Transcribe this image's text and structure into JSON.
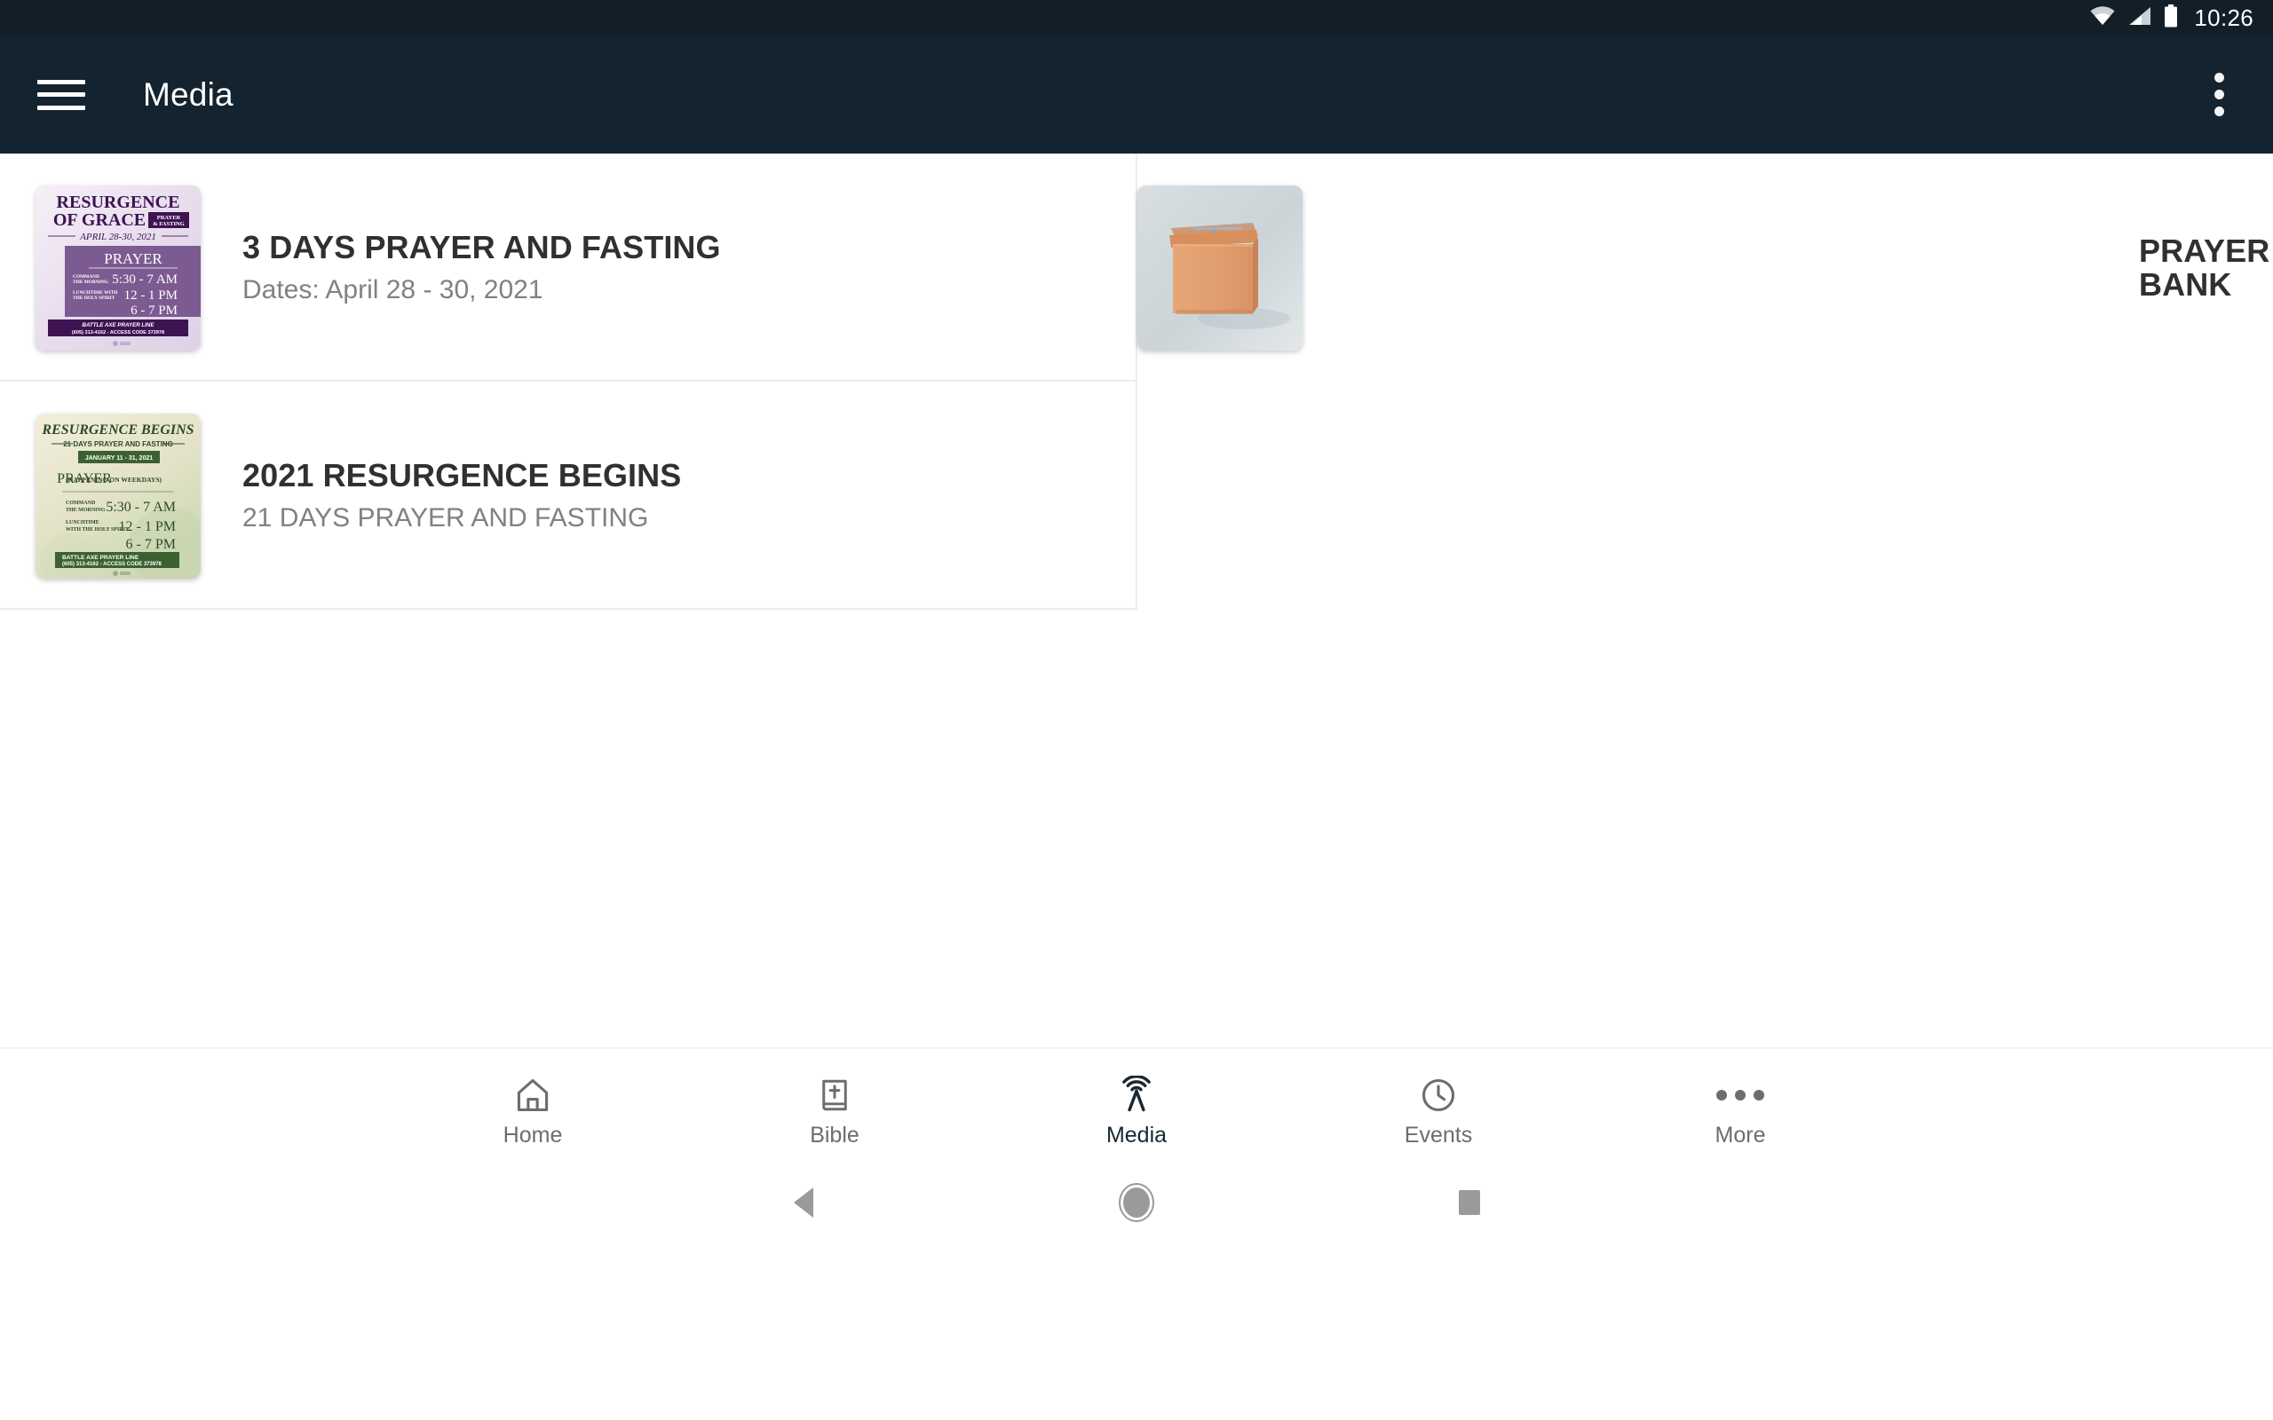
{
  "status_bar": {
    "time": "10:26",
    "icons": [
      "wifi-icon",
      "cellular-signal-icon",
      "battery-icon"
    ]
  },
  "app_bar": {
    "menu_icon": "hamburger-menu-icon",
    "title": "Media",
    "overflow_icon": "overflow-menu-icon",
    "background_color": "#132330"
  },
  "media_items": [
    {
      "title": "3 DAYS PRAYER AND FASTING",
      "subtitle": "Dates: April 28 - 30, 2021",
      "thumbnail_name": "resurgence-of-grace-flyer-thumbnail",
      "thumbnail_text": {
        "heading_1": "RESURGENCE",
        "heading_2": "OF GRACE",
        "badge_1": "PRAYER",
        "badge_2": "& FASTING",
        "dates": "APRIL 28-30, 2021",
        "section": "PRAYER",
        "rows": [
          {
            "label_1": "COMMAND",
            "label_2": "THE MORNING",
            "time": "5:30 - 7 AM"
          },
          {
            "label_1": "LUNCHTIME WITH",
            "label_2": "THE HOLY SPIRIT",
            "time": "12 - 1 PM"
          },
          {
            "label_1": "",
            "label_2": "",
            "time": "6 - 7 PM"
          }
        ],
        "footer_1": "BATTLE AXE PRAYER LINE",
        "footer_2": "(605) 313-4162 - ACCESS CODE 373978"
      }
    },
    {
      "title": "PRAYER BANK",
      "subtitle": "",
      "thumbnail_name": "prayer-bank-wooden-box-thumbnail",
      "thumbnail_text": null
    },
    {
      "title": "2021 RESURGENCE BEGINS",
      "subtitle": "21 DAYS PRAYER AND FASTING",
      "thumbnail_name": "resurgence-begins-flyer-thumbnail",
      "thumbnail_text": {
        "heading_1": "RESURGENCE BEGINS",
        "heading_2": "21 DAYS PRAYER AND FASTING",
        "dates": "JANUARY 11 - 31, 2021",
        "section": "PRAYER",
        "section_note": "(HAPPENING ON WEEKDAYS)",
        "rows": [
          {
            "label_1": "COMMAND",
            "label_2": "THE MORNING",
            "time": "5:30 - 7 AM"
          },
          {
            "label_1": "LUNCHTIME",
            "label_2": "WITH THE HOLY SPIRIT",
            "time": "12 - 1 PM"
          },
          {
            "label_1": "",
            "label_2": "",
            "time": "6 - 7 PM"
          }
        ],
        "footer_1": "BATTLE AXE PRAYER LINE",
        "footer_2": "(605) 313-4162 - ACCESS CODE 373978"
      }
    }
  ],
  "tab_bar": {
    "active_color": "#1a2832",
    "inactive_color": "#6d6d6d",
    "tabs": [
      {
        "label": "Home",
        "icon": "home-icon",
        "active": false
      },
      {
        "label": "Bible",
        "icon": "bible-book-icon",
        "active": false
      },
      {
        "label": "Media",
        "icon": "broadcast-icon",
        "active": true
      },
      {
        "label": "Events",
        "icon": "clock-icon",
        "active": false
      },
      {
        "label": "More",
        "icon": "more-dots-icon",
        "active": false
      }
    ]
  },
  "system_nav": {
    "back": "back-triangle-icon",
    "home": "home-circle-icon",
    "recents": "recents-square-icon"
  }
}
